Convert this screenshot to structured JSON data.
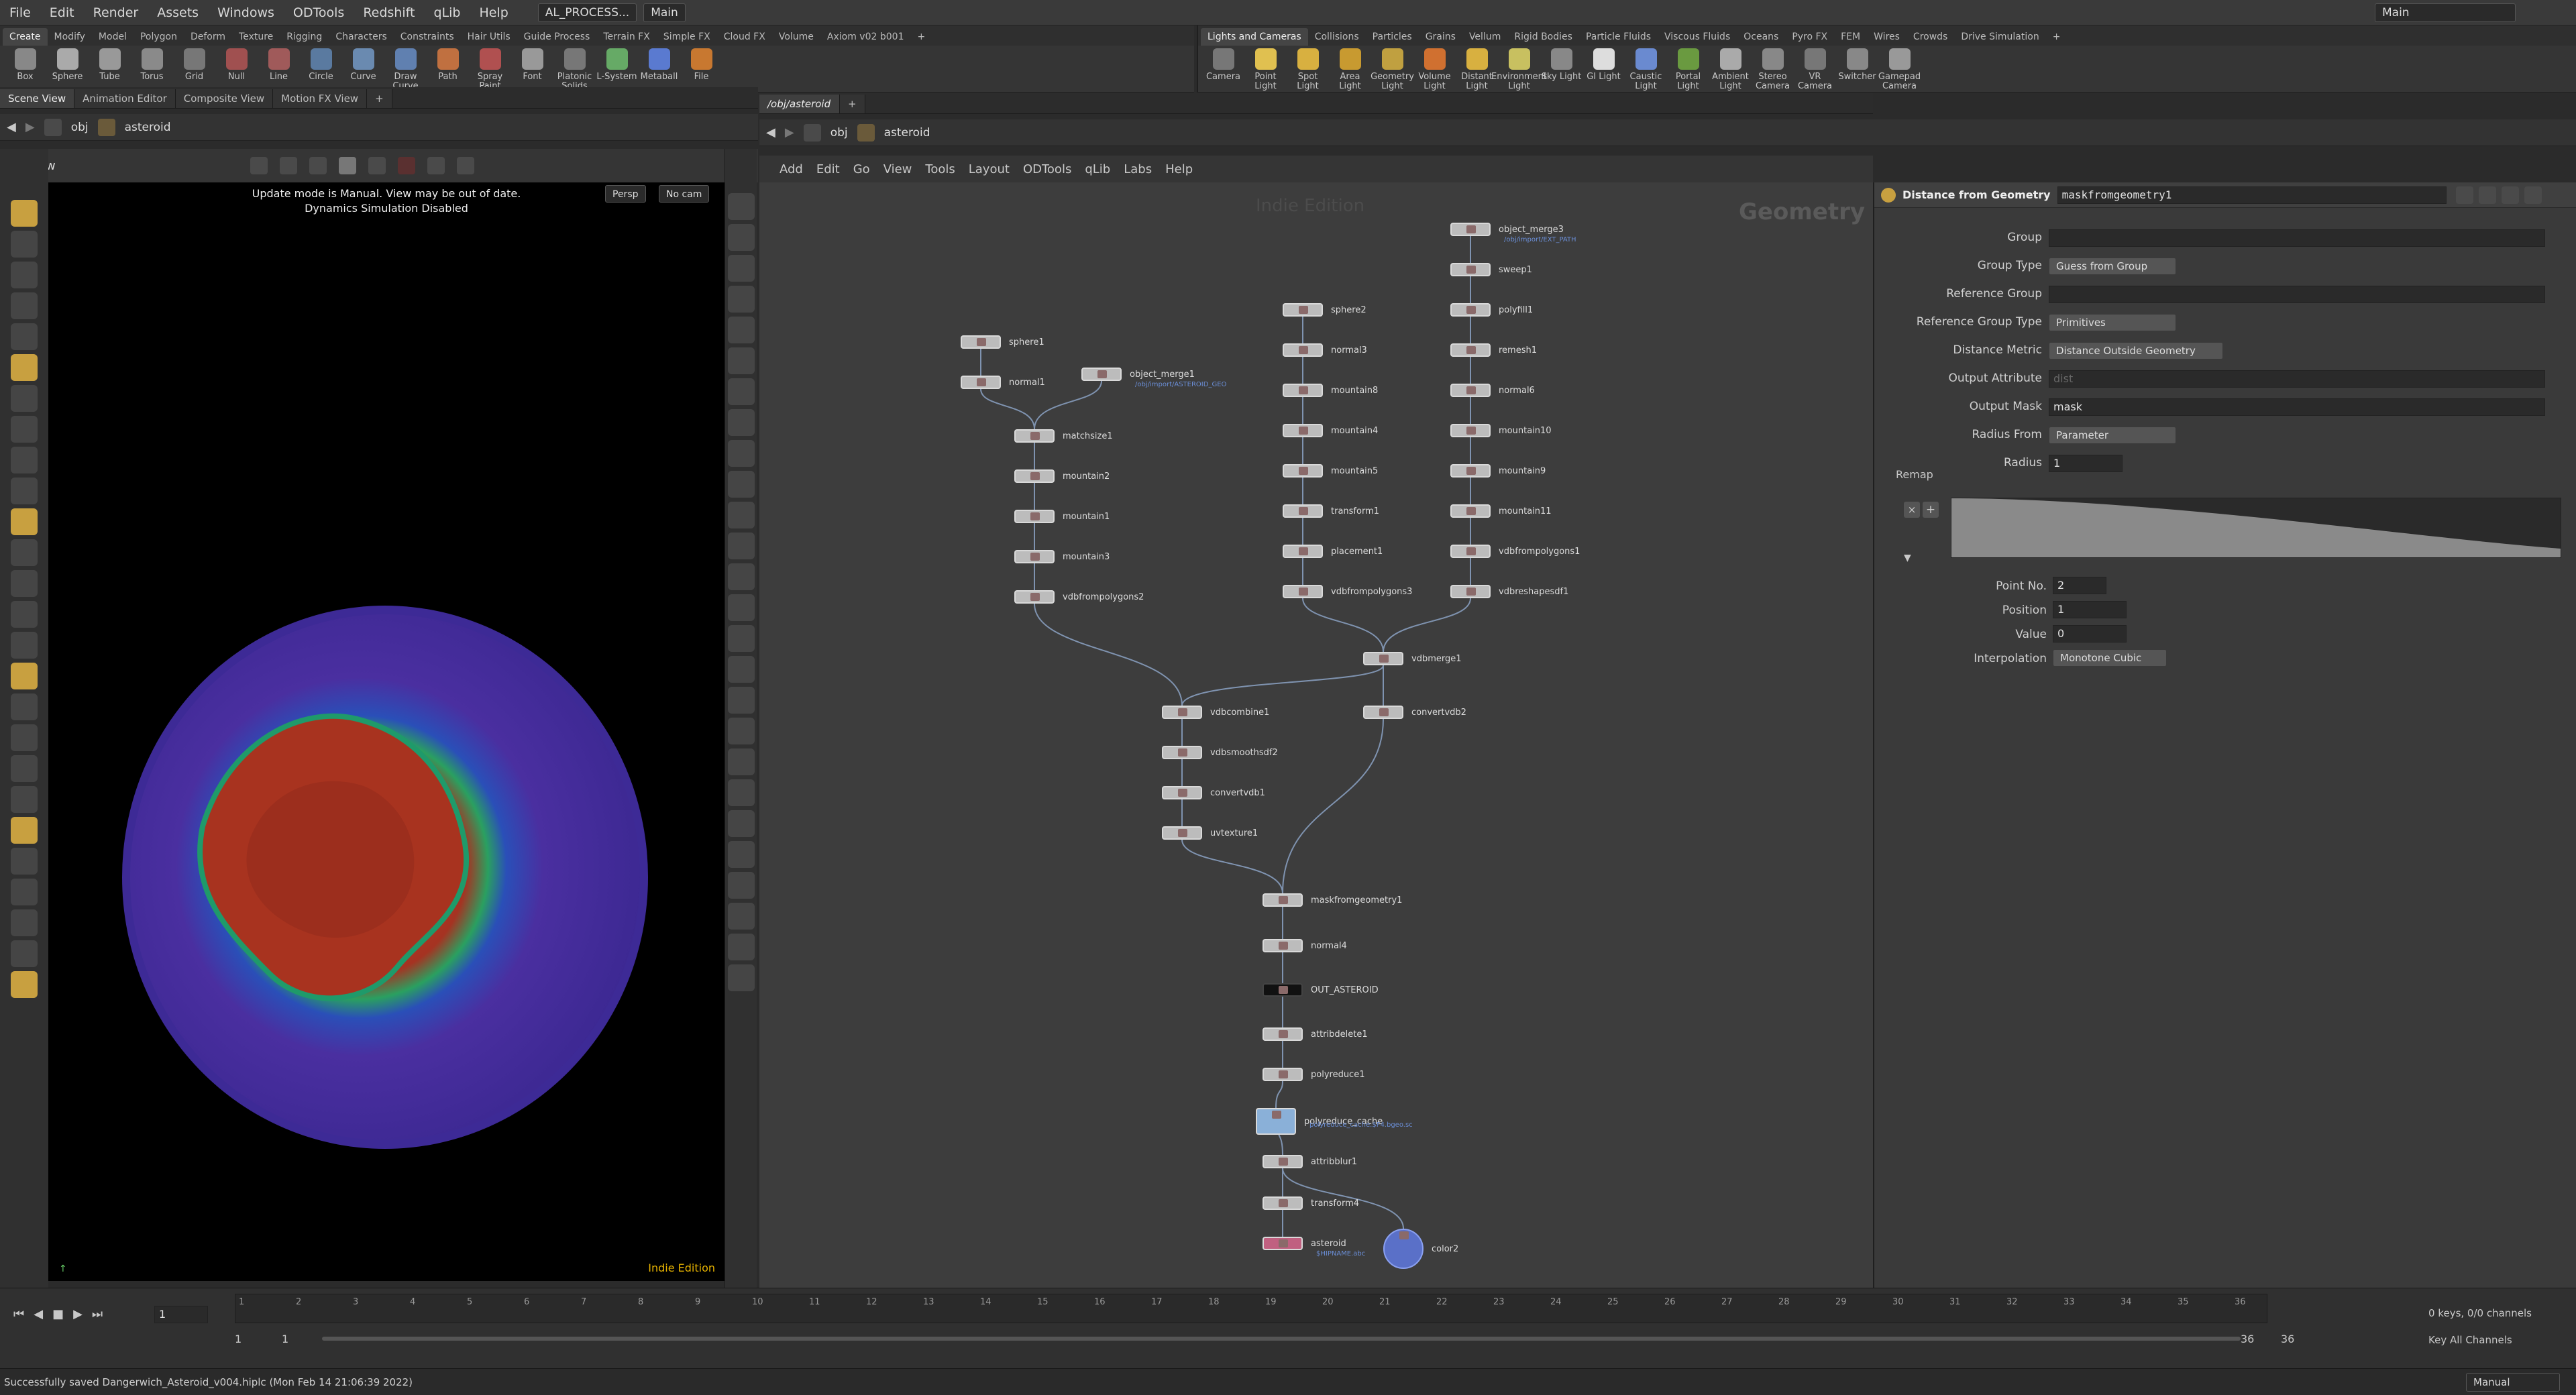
{
  "menubar": {
    "items": [
      "File",
      "Edit",
      "Render",
      "Assets",
      "Windows",
      "ODTools",
      "Redshift",
      "qLib",
      "Help"
    ],
    "desktop": "AL_PROCESS...",
    "context": "Main",
    "right_desktop": "Main"
  },
  "shelf_left": {
    "tabs": [
      "Create",
      "Modify",
      "Model",
      "Polygon",
      "Deform",
      "Texture",
      "Rigging",
      "Characters",
      "Constraints",
      "Hair Utils",
      "Guide Process",
      "Terrain FX",
      "Simple FX",
      "Cloud FX",
      "Volume",
      "Axiom v02 b001"
    ],
    "tools": [
      "Box",
      "Sphere",
      "Tube",
      "Torus",
      "Grid",
      "Null",
      "Line",
      "Circle",
      "Curve",
      "Draw Curve",
      "Path",
      "Spray Paint",
      "Font",
      "Platonic Solids",
      "L-System",
      "Metaball",
      "File"
    ]
  },
  "shelf_right": {
    "tabs": [
      "Lights and Cameras",
      "Collisions",
      "Particles",
      "Grains",
      "Vellum",
      "Rigid Bodies",
      "Particle Fluids",
      "Viscous Fluids",
      "Oceans",
      "Pyro FX",
      "FEM",
      "Wires",
      "Crowds",
      "Drive Simulation"
    ],
    "tools": [
      "Camera",
      "Point Light",
      "Spot Light",
      "Area Light",
      "Geometry Light",
      "Volume Light",
      "Distant Light",
      "Environment Light",
      "Sky Light",
      "GI Light",
      "Caustic Light",
      "Portal Light",
      "Ambient Light",
      "Stereo Camera",
      "VR Camera",
      "Switcher",
      "Gamepad Camera"
    ]
  },
  "left_tabs": [
    "Scene View",
    "Animation Editor",
    "Composite View",
    "Motion FX View"
  ],
  "left_path": {
    "root": "obj",
    "node": "asteroid"
  },
  "viewport": {
    "title": "View",
    "msg1": "Update mode is Manual. View may be out of date.",
    "msg2": "Dynamics Simulation Disabled",
    "persp": "Persp",
    "cam": "No cam",
    "edition": "Indie Edition"
  },
  "net_tab": "/obj/asteroid",
  "net_path": {
    "root": "obj",
    "node": "asteroid"
  },
  "net_menu": [
    "Add",
    "Edit",
    "Go",
    "View",
    "Tools",
    "Layout",
    "ODTools",
    "qLib",
    "Labs",
    "Help"
  ],
  "net_watermark": {
    "edition": "Indie Edition",
    "context": "Geometry"
  },
  "nodes": [
    {
      "label": "sphere1",
      "sub": ""
    },
    {
      "label": "normal1",
      "sub": ""
    },
    {
      "label": "object_merge1",
      "sub": "/obj/import/ASTEROID_GEO"
    },
    {
      "label": "matchsize1",
      "sub": ""
    },
    {
      "label": "mountain2",
      "sub": ""
    },
    {
      "label": "mountain1",
      "sub": ""
    },
    {
      "label": "mountain3",
      "sub": ""
    },
    {
      "label": "vdbfrompolygons2",
      "sub": ""
    },
    {
      "label": "sphere2",
      "sub": ""
    },
    {
      "label": "normal3",
      "sub": ""
    },
    {
      "label": "mountain8",
      "sub": ""
    },
    {
      "label": "mountain4",
      "sub": ""
    },
    {
      "label": "mountain5",
      "sub": ""
    },
    {
      "label": "transform1",
      "sub": ""
    },
    {
      "label": "placement1",
      "sub": ""
    },
    {
      "label": "vdbfrompolygons3",
      "sub": ""
    },
    {
      "label": "object_merge3",
      "sub": "/obj/import/EXT_PATH"
    },
    {
      "label": "sweep1",
      "sub": ""
    },
    {
      "label": "polyfill1",
      "sub": ""
    },
    {
      "label": "remesh1",
      "sub": ""
    },
    {
      "label": "normal6",
      "sub": ""
    },
    {
      "label": "mountain10",
      "sub": ""
    },
    {
      "label": "mountain9",
      "sub": ""
    },
    {
      "label": "mountain11",
      "sub": ""
    },
    {
      "label": "vdbfrompolygons1",
      "sub": ""
    },
    {
      "label": "vdbreshapesdf1",
      "sub": ""
    },
    {
      "label": "vdbmerge1",
      "sub": ""
    },
    {
      "label": "vdbcombine1",
      "sub": ""
    },
    {
      "label": "convertvdb2",
      "sub": ""
    },
    {
      "label": "vdbsmoothsdf2",
      "sub": ""
    },
    {
      "label": "convertvdb1",
      "sub": ""
    },
    {
      "label": "uvtexture1",
      "sub": ""
    },
    {
      "label": "maskfromgeometry1",
      "sub": ""
    },
    {
      "label": "normal4",
      "sub": ""
    },
    {
      "label": "OUT_ASTEROID",
      "sub": ""
    },
    {
      "label": "attribdelete1",
      "sub": ""
    },
    {
      "label": "polyreduce1",
      "sub": ""
    },
    {
      "label": "polyreduce_cache",
      "sub": "polyreduce_cache.$F4.bgeo.sc"
    },
    {
      "label": "attribblur1",
      "sub": ""
    },
    {
      "label": "transform4",
      "sub": ""
    },
    {
      "label": "asteroid",
      "sub": "$HIPNAME.abc"
    },
    {
      "label": "color2",
      "sub": ""
    }
  ],
  "parms": {
    "type": "Distance from Geometry",
    "name": "maskfromgeometry1",
    "rows": [
      {
        "label": "Group",
        "value": ""
      },
      {
        "label": "Group Type",
        "value": "Guess from Group"
      },
      {
        "label": "Reference Group",
        "value": ""
      },
      {
        "label": "Reference Group Type",
        "value": "Primitives"
      },
      {
        "label": "Distance Metric",
        "value": "Distance Outside Geometry"
      },
      {
        "label": "Output Attribute",
        "value": "dist"
      },
      {
        "label": "Output Mask",
        "value": "mask"
      },
      {
        "label": "Radius From",
        "value": "Parameter"
      },
      {
        "label": "Radius",
        "value": "1"
      }
    ],
    "remap_label": "Remap",
    "point_no_label": "Point No.",
    "point_no": "2",
    "position_label": "Position",
    "position": "1",
    "value_label": "Value",
    "value": "0",
    "interp_label": "Interpolation",
    "interp": "Monotone Cubic"
  },
  "timeline": {
    "ticks": [
      "1",
      "2",
      "3",
      "4",
      "5",
      "6",
      "7",
      "8",
      "9",
      "10",
      "11",
      "12",
      "13",
      "14",
      "15",
      "16",
      "17",
      "18",
      "19",
      "20",
      "21",
      "22",
      "23",
      "24",
      "25",
      "26",
      "27",
      "28",
      "29",
      "30",
      "31",
      "32",
      "33",
      "34",
      "35",
      "36"
    ],
    "frame": "1",
    "start": "1",
    "start2": "1",
    "end": "36",
    "end2": "36",
    "keys": "0 keys, 0/0 channels",
    "key_all": "Key All Channels",
    "mode": "Manual"
  },
  "status": "Successfully saved Dangerwich_Asteroid_v004.hiplc (Mon Feb 14 21:06:39 2022)"
}
